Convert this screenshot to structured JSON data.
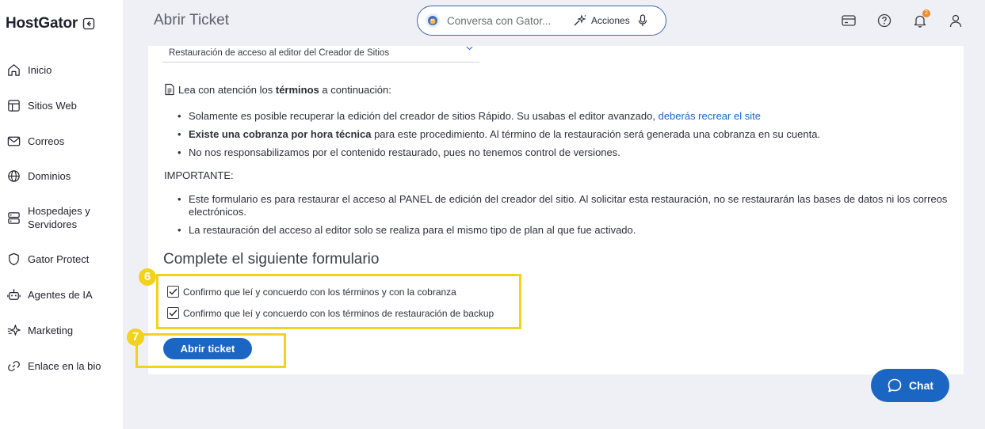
{
  "app": {
    "logo": "HostGator",
    "page_title": "Abrir Ticket"
  },
  "sidebar": {
    "items": [
      {
        "label": "Inicio",
        "icon": "home-icon"
      },
      {
        "label": "Sitios Web",
        "icon": "layout-icon"
      },
      {
        "label": "Correos",
        "icon": "mail-icon"
      },
      {
        "label": "Dominios",
        "icon": "globe-icon"
      },
      {
        "label": "Hospedajes y Servidores",
        "icon": "server-icon"
      },
      {
        "label": "Gator Protect",
        "icon": "shield-icon"
      },
      {
        "label": "Agentes de IA",
        "icon": "robot-icon"
      },
      {
        "label": "Marketing",
        "icon": "sparkle-icon"
      },
      {
        "label": "Enlace en la bio",
        "icon": "link-icon"
      }
    ]
  },
  "header": {
    "search_placeholder": "Conversa con Gator...",
    "actions_label": "Acciones",
    "notifications_count": "2"
  },
  "content": {
    "select_value": "Restauración de acceso al editor del Creador de Sitios",
    "read_intro_pre": "Lea con atención los ",
    "read_intro_bold": "términos",
    "read_intro_post": " a continuación:",
    "terms": [
      {
        "pre": "Solamente es posible recuperar la edición del creador de sitios Rápido. Su usabas el editor avanzado, ",
        "link": "deberás recrear el site"
      },
      {
        "bold": "Existe una cobranza por hora técnica",
        "post": " para este procedimiento. Al término de la restauración será generada una cobranza en su cuenta."
      },
      {
        "text": "No nos responsabilizamos por el contenido restaurado, pues no tenemos control de versiones."
      }
    ],
    "important_label": "IMPORTANTE:",
    "important_items": [
      "Este formulario es para restaurar el acceso al PANEL de edición del creador del sitio. Al solicitar esta restauración, no se restaurarán las bases de datos ni los correos electrónicos.",
      "La restauración del acceso al editor solo se realiza para el mismo tipo de plan al que fue activado."
    ],
    "form_title": "Complete el siguiente formulario",
    "checkboxes": [
      {
        "label": "Confirmo que leí y concuerdo con los términos y con la cobranza",
        "checked": true
      },
      {
        "label": "Confirmo que leí y concuerdo con los términos de restauración de backup",
        "checked": true
      }
    ],
    "submit_label": "Abrir ticket"
  },
  "annotations": {
    "step_6": "6",
    "step_7": "7",
    "highlight_color": "#f2d21d"
  },
  "chat": {
    "label": "Chat"
  },
  "colors": {
    "brand_blue": "#1a66c2",
    "accent_orange": "#f08a24"
  }
}
